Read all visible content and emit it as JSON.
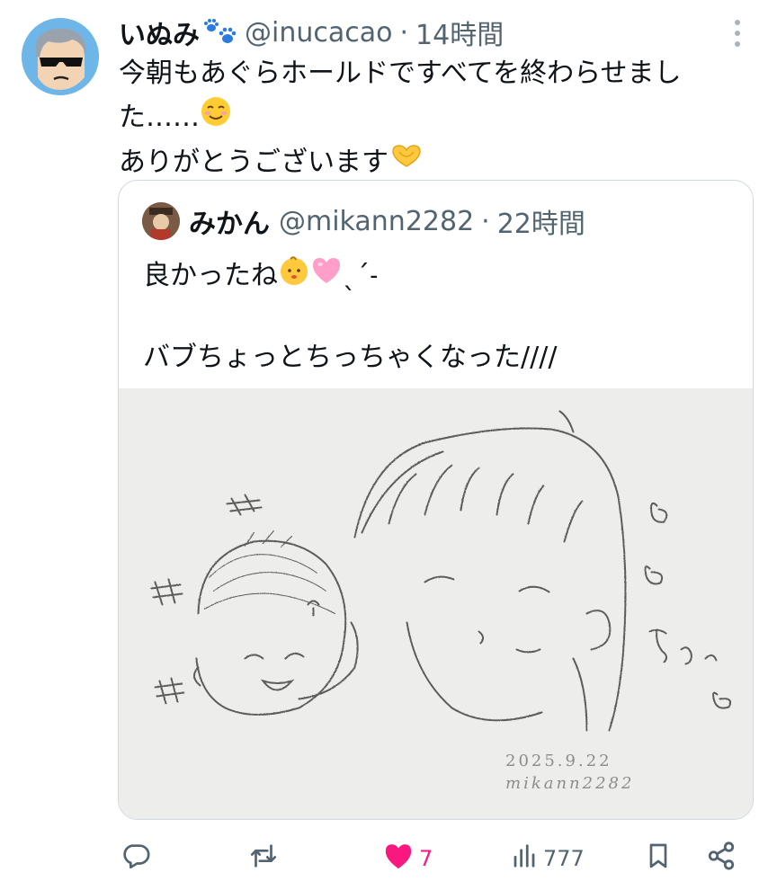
{
  "tweet": {
    "author_name": "いぬみ",
    "author_handle": "@inucacao",
    "separator": "·",
    "time": "14時間",
    "name_emoji_icon": "paw-prints-icon",
    "text_lines": [
      "今朝もあぐらホールドですべてを終わらせまし",
      "た……"
    ],
    "text_line2_emoji_icon": "smiling-face-icon",
    "text_line3": "ありがとうございます",
    "text_line3_emoji_icon": "heart-hands-icon"
  },
  "quote": {
    "author_name": "みかん",
    "author_handle": "@mikann2282",
    "separator": "·",
    "time": "22時間",
    "line1": "良かったね",
    "line1_emoji_icons": [
      "baby-icon",
      "pink-heart-icon"
    ],
    "line1_tail": "ˎˊ˗",
    "line2": "",
    "line3": "バブちょっとちっちゃくなった////",
    "image_signature": {
      "date": "2025.9.22",
      "name": "mikann2282"
    },
    "image_text": {
      "chu": "ちゅっ"
    }
  },
  "actions": {
    "reply_icon": "reply-icon",
    "retweet_icon": "retweet-icon",
    "like_icon": "heart-icon",
    "like_count": "7",
    "views_icon": "bar-chart-icon",
    "views_count": "777",
    "bookmark_icon": "bookmark-icon",
    "share_icon": "share-icon"
  },
  "colors": {
    "text": "#0f1419",
    "secondary": "#536471",
    "like_pink": "#f91880",
    "border": "#cfd9de",
    "avatar_bg": "#6fb6e8"
  }
}
